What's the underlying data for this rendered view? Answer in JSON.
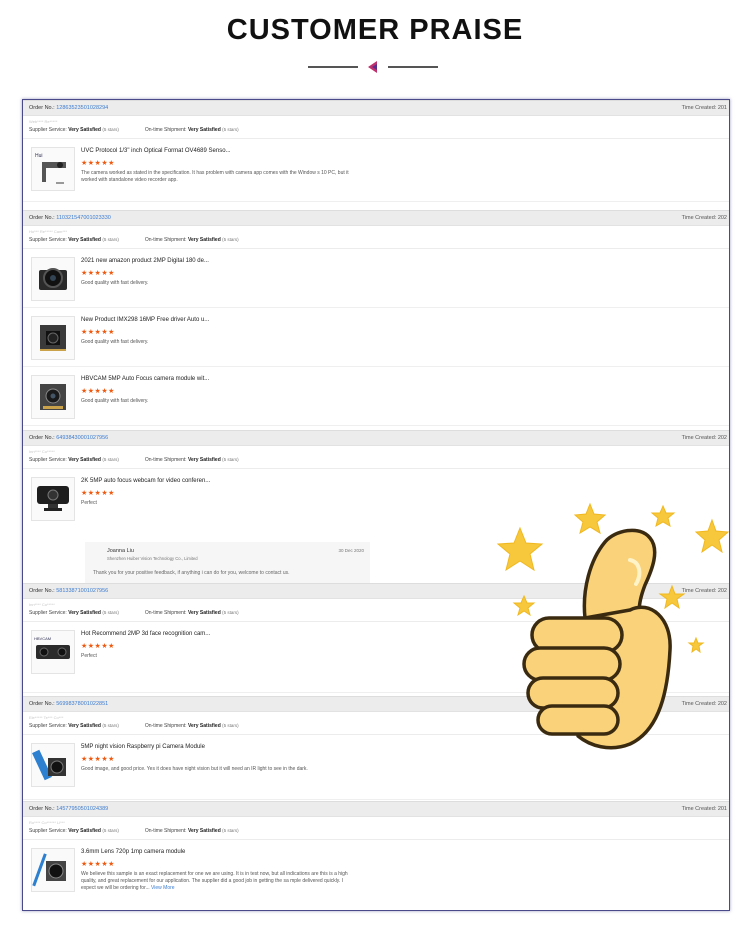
{
  "header": {
    "title": "CUSTOMER PRAISE"
  },
  "labels": {
    "order_no": "Order No.: ",
    "time_created": "Time Created: ",
    "supplier_service": "Supplier Service: ",
    "on_time_shipment": "On-time Shipment: ",
    "very_satisfied": "Very Satisfied",
    "five_stars": "(5 stars)",
    "stars": "★★★★★"
  },
  "orders": [
    {
      "order_no": "1286352350102829­4",
      "time": "201",
      "buyer": "Web**** Re*****",
      "items": [
        {
          "name": "UVC Protocol 1/3\" inch Optical Format OV4689 Senso...",
          "review": "The camera worked as stated in the specification.  It has problem with camera app comes with the Window s 10 PC, but it worked with standalone video recorder app."
        }
      ]
    },
    {
      "order_no": "110321547001023330",
      "time": "202",
      "buyer": "Ho*** Re***** Cam***",
      "items": [
        {
          "name": "2021 new amazon product 2MP Digital 180 de...",
          "review": "Good quality with fast delivery."
        },
        {
          "name": "New Product IMX298 16MP Free driver Auto u...",
          "review": "Good quality with fast delivery."
        },
        {
          "name": "HBVCAM 5MP Auto Focus camera module wit...",
          "review": "Good quality with fast delivery."
        }
      ]
    },
    {
      "order_no": "64938430001027956",
      "time": "202",
      "buyer": "Inn**** Co*****",
      "items": [
        {
          "name": "2K 5MP auto focus webcam for video conferen...",
          "review": "Perfect"
        }
      ],
      "reply": {
        "name": "Joanna Liu",
        "company": "Shenzhen Huiber Vision Technology Co., Limited",
        "date": "30 Dec 2020",
        "text": "Thank you for your positive feedback, if anything i can do for you, welcome to contact us."
      }
    },
    {
      "order_no": "58133871001027956",
      "time": "202",
      "buyer": "Inn**** Co*****",
      "items": [
        {
          "name": "Hot Recommend 2MP 3d face recognition cam...",
          "review": "Perfect"
        }
      ]
    },
    {
      "order_no": "56998378001022851",
      "time": "202",
      "buyer": "Ele***** Te*** Co***",
      "items": [
        {
          "name": "5MP night vision Raspberry pi Camera Module",
          "review": "Good image, and good price. Yes it does have night vision but it will need an IR light to see in the dark."
        }
      ]
    },
    {
      "order_no": "145779505010243­89",
      "time": "201",
      "buyer": "Ro**** Co****** Li***",
      "items": [
        {
          "name": "3.6mm Lens 720p 1mp camera module",
          "review": "We believe this sample is an exact replacement for one we are using. It is in test now, but all indications are this is a high quality, and great replacement for our application. The supplier did a good job in getting the sa mple delivered quickly. I expect we will be ordering for...",
          "more": "View More"
        }
      ]
    }
  ]
}
